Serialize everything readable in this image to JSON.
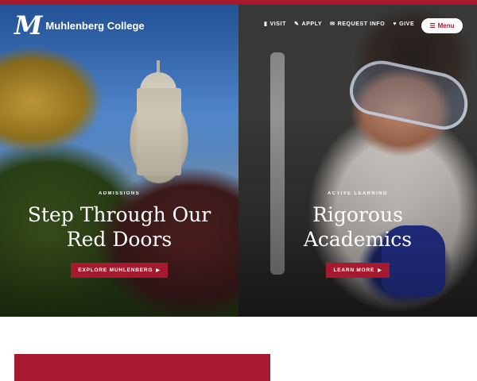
{
  "brand": {
    "name": "Muhlenberg College",
    "mark": "M",
    "accent": "#a6192e"
  },
  "utility_nav": [
    {
      "icon": "map-icon",
      "glyph": "▮",
      "label": "VISIT"
    },
    {
      "icon": "pencil-icon",
      "glyph": "✎",
      "label": "APPLY"
    },
    {
      "icon": "envelope-icon",
      "glyph": "✉",
      "label": "REQUEST INFO"
    },
    {
      "icon": "heart-icon",
      "glyph": "♥",
      "label": "GIVE"
    }
  ],
  "menu": {
    "label": "Menu",
    "icon": "menu-search-icon",
    "glyph": "☰"
  },
  "panels": [
    {
      "eyebrow": "ADMISSIONS",
      "heading_line1": "Step Through Our",
      "heading_line2": "Red Doors",
      "button": "EXPLORE MUHLENBERG"
    },
    {
      "eyebrow": "ACTIVE LEARNING",
      "heading_line1": "Rigorous",
      "heading_line2": "Academics",
      "button": "LEARN MORE"
    }
  ]
}
